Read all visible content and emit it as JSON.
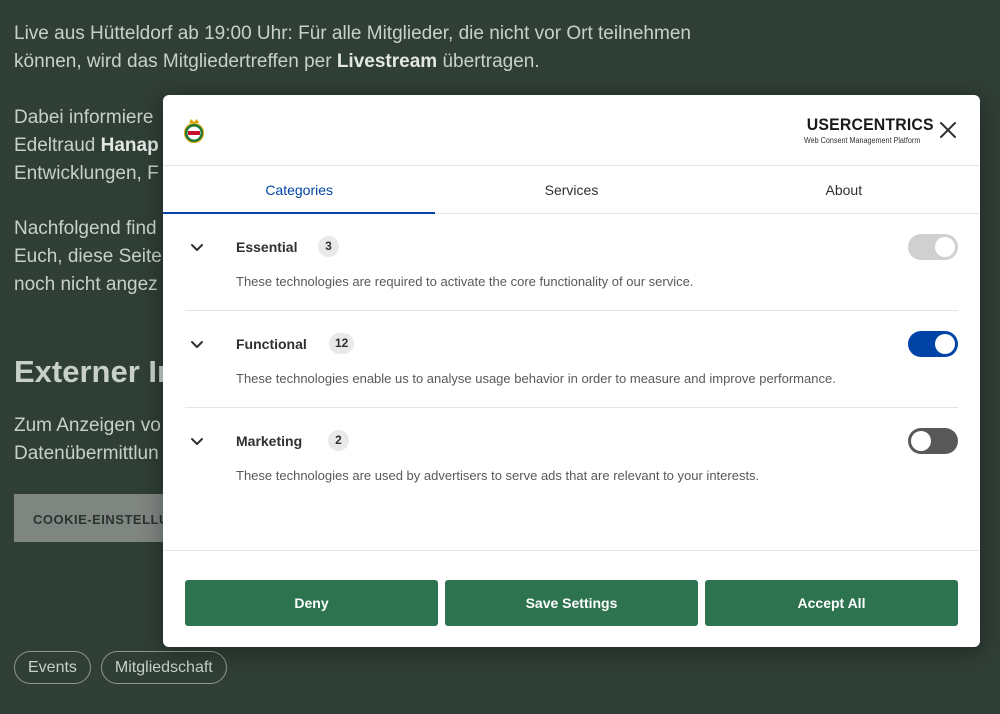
{
  "background": {
    "para1_a": "Live aus Hütteldorf ab 19:00 Uhr: Für alle Mitglieder, die nicht vor Ort teilnehmen",
    "para1_b": "können, wird das Mitgliedertreffen per ",
    "para1_bold": "Livestream",
    "para1_c": " übertragen.",
    "para2_line1": "Dabei informiere",
    "para2_line2_a": "Edeltraud ",
    "para2_line2_bold": "Hanap",
    "para2_line3": "Entwicklungen, F",
    "para3_line1": "Nachfolgend find",
    "para3_line2": "Euch, diese Seite",
    "para3_line3": "noch nicht angez",
    "heading": "Externer In",
    "para4_line1": "Zum Anzeigen vo",
    "para4_line2": "Datenübermittlun",
    "cookie_button": "COOKIE-EINSTELLUNGEN",
    "tags": [
      "Events",
      "Mitgliedschaft"
    ]
  },
  "modal": {
    "brand": {
      "name": "USERCENTRICS",
      "subtitle": "Web Consent Management Platform",
      "club_logo_icon": "club-crest-icon",
      "shield_icon": "shield-icon"
    },
    "close_icon": "close-icon",
    "tabs": [
      {
        "label": "Categories",
        "active": true
      },
      {
        "label": "Services",
        "active": false
      },
      {
        "label": "About",
        "active": false
      }
    ],
    "categories": [
      {
        "name": "Essential",
        "count": "3",
        "description": "These technologies are required to activate the core functionality of our service.",
        "toggle": "disabled-on"
      },
      {
        "name": "Functional",
        "count": "12",
        "description": "These technologies enable us to analyse usage behavior in order to measure and improve performance.",
        "toggle": "on"
      },
      {
        "name": "Marketing",
        "count": "2",
        "description": "These technologies are used by advertisers to serve ads that are relevant to your interests.",
        "toggle": "off"
      }
    ],
    "buttons": {
      "deny": "Deny",
      "save": "Save Settings",
      "accept": "Accept All"
    },
    "colors": {
      "accent": "#0045a5",
      "button": "#2d7350",
      "toggle_disabled": "#d0d0d0",
      "toggle_off": "#595959"
    }
  }
}
